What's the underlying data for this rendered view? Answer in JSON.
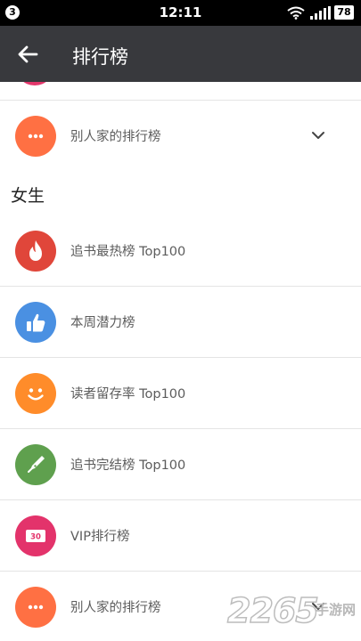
{
  "status_bar": {
    "notification_count": "3",
    "time": "12:11",
    "battery": "78"
  },
  "app_bar": {
    "title": "排行榜",
    "back_icon": "arrow-left-icon"
  },
  "colors": {
    "app_bar_bg": "#38393d",
    "status_bar_bg": "#000000",
    "label_text": "#5c5c5c"
  },
  "top_item": {
    "label": "别人家的排行榜",
    "icon": "more-dots-icon",
    "color": "#ff7043"
  },
  "section": {
    "title": "女生"
  },
  "items": [
    {
      "label": "追书最热榜 Top100",
      "icon": "flame-icon",
      "color": "#e0463a"
    },
    {
      "label": "本周潜力榜",
      "icon": "thumbs-up-icon",
      "color": "#4a90e2"
    },
    {
      "label": "读者留存率 Top100",
      "icon": "smiley-icon",
      "color": "#ff8c2a"
    },
    {
      "label": "追书完结榜 Top100",
      "icon": "pen-nib-icon",
      "color": "#5fa04e"
    },
    {
      "label": "VIP排行榜",
      "icon": "vip-ticket-icon",
      "color": "#e3336b",
      "badge_text": "30"
    },
    {
      "label": "别人家的排行榜",
      "icon": "more-dots-icon",
      "color": "#ff7043"
    }
  ],
  "watermark": {
    "digits": "2265",
    "suffix": "手游网",
    "domain": ".com"
  }
}
